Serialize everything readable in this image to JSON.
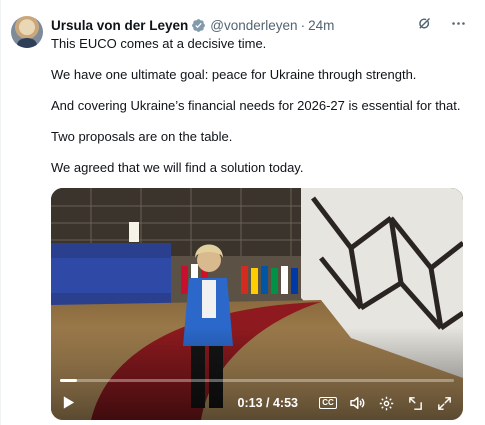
{
  "tweet": {
    "author_name": "Ursula von der Leyen",
    "handle": "@vonderleyen",
    "separator": "·",
    "time": "24m",
    "paragraphs": [
      "This EUCO comes at a decisive time.",
      "We have one ultimate goal: peace for Ukraine through strength.",
      "And covering Ukraine’s financial needs for 2026-27 is essential for that.",
      "Two proposals are on the table.",
      "We agreed that we will find a solution today."
    ]
  },
  "video": {
    "timecode": "0:13 / 4:53",
    "progress_fraction": 0.044,
    "cc_label": "CC"
  },
  "colors": {
    "verified": "#829aab",
    "muted_text": "#536471"
  },
  "icons": [
    "verified-badge-icon",
    "grok-icon",
    "more-icon",
    "play-icon",
    "captions-icon",
    "volume-icon",
    "settings-icon",
    "pop-out-icon",
    "fullscreen-icon"
  ]
}
